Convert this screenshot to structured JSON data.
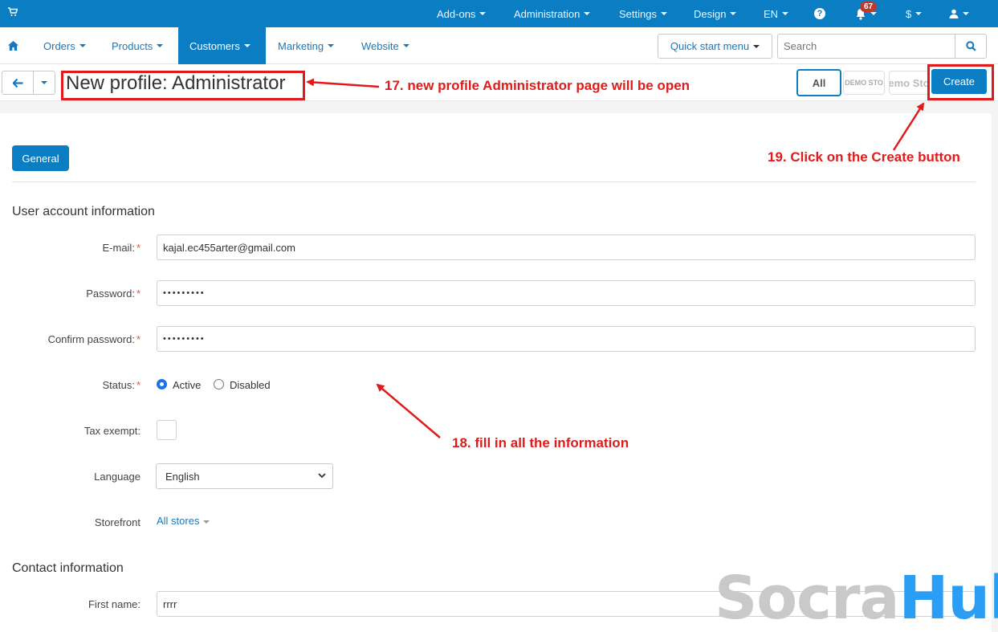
{
  "topbar": {
    "items": [
      "Add-ons",
      "Administration",
      "Settings",
      "Design",
      "EN"
    ],
    "notifications_count": "67",
    "currency": "$"
  },
  "nav": {
    "items": [
      "Orders",
      "Products",
      "Customers",
      "Marketing",
      "Website"
    ],
    "active": "Customers",
    "quick_start": "Quick start menu",
    "search_placeholder": "Search"
  },
  "titlebar": {
    "title": "New profile: Administrator",
    "all_label": "All",
    "store1": "DEMO STO",
    "store2": "emo Sto",
    "create_label": "Create"
  },
  "tabs": {
    "general": "General"
  },
  "user_account": {
    "section_title": "User account information",
    "email_label": "E-mail:",
    "email_value": "kajal.ec455arter@gmail.com",
    "password_label": "Password:",
    "password_value": "•••••••••",
    "confirm_label": "Confirm password:",
    "confirm_value": "•••••••••",
    "status_label": "Status:",
    "status_active": "Active",
    "status_disabled": "Disabled",
    "tax_label": "Tax exempt:",
    "language_label": "Language",
    "language_value": "English",
    "storefront_label": "Storefront",
    "storefront_value": "All stores"
  },
  "contact": {
    "section_title": "Contact information",
    "first_name_label": "First name:",
    "first_name_value": "rrrr"
  },
  "annotations": {
    "step17": "17. new profile Administrator page will be open",
    "step18": "18. fill in all the information",
    "step19": "19. Click on the Create button"
  },
  "watermark": {
    "part1": "Socra",
    "part2": "Hub"
  },
  "colors": {
    "accent": "#0b7dc2",
    "annotation": "#e01b1b"
  }
}
